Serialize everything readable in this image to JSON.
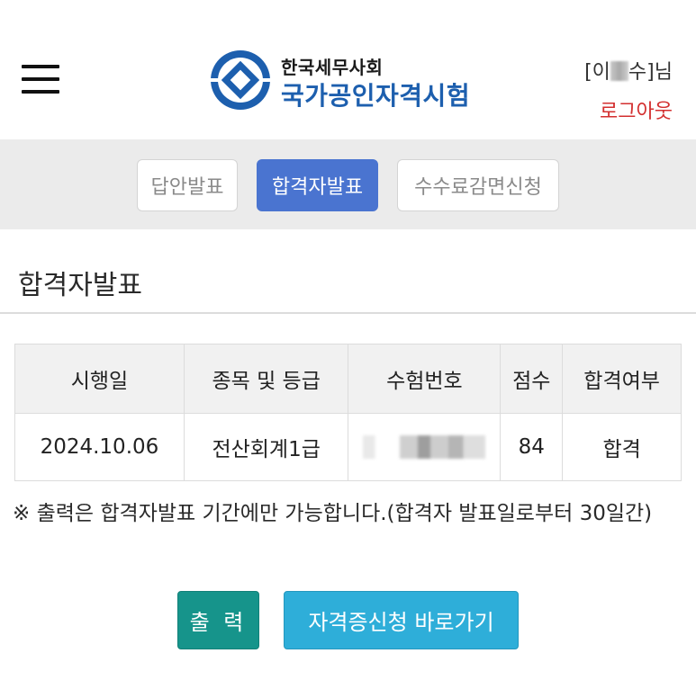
{
  "header": {
    "menu_icon": "hamburger-menu-icon",
    "logo": {
      "org_name": "한국세무사회",
      "exam_title": "국가공인자격시험",
      "mark_icon": "diamond-emblem-icon",
      "brand_color": "#1d5fae"
    },
    "user": {
      "prefix": "[이",
      "suffix": "수]님",
      "logout_label": "로그아웃",
      "logout_color": "#d32f2f"
    }
  },
  "tabs": [
    {
      "label": "답안발표",
      "active": false
    },
    {
      "label": "합격자발표",
      "active": true
    },
    {
      "label": "수수료감면신청",
      "active": false
    }
  ],
  "page_title": "합격자발표",
  "results_table": {
    "headers": [
      "시행일",
      "종목 및 등급",
      "수험번호",
      "점수",
      "합격여부"
    ],
    "rows": [
      {
        "date": "2024.10.06",
        "subject": "전산회계1급",
        "exam_number": "",
        "score": "84",
        "result": "합격"
      }
    ]
  },
  "notice": "※ 출력은 합격자발표 기간에만 가능합니다.(합격자 발표일로부터 30일간)",
  "buttons": {
    "print_label": "출 력",
    "certificate_label": "자격증신청 바로가기"
  },
  "colors": {
    "active_tab": "#4a74d0",
    "print_button": "#16948b",
    "certificate_button": "#2eaed9"
  }
}
